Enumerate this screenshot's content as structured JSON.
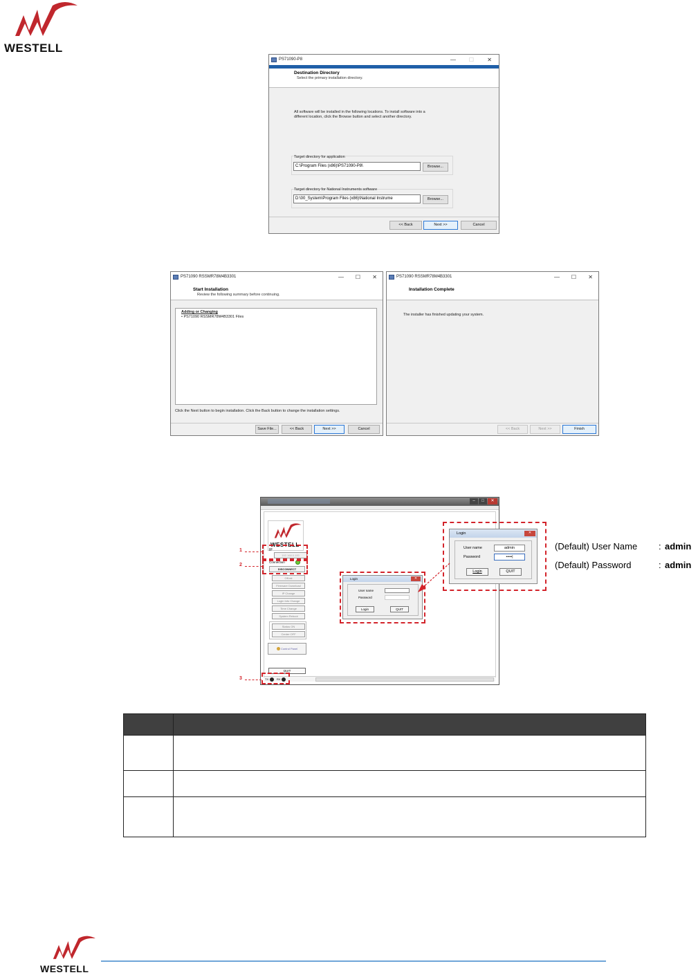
{
  "brand": {
    "logo_text": "WESTELL",
    "footer_logo_text": "WESTELL",
    "logo_color": "#c0272d",
    "footer_line_color": "#6fa5d8"
  },
  "installer_destination": {
    "title": "PS71090-P8",
    "header_title": "Destination Directory",
    "header_subtitle": "Select the primary installation directory.",
    "body_line1": "All software will be installed in the following locations. To install software into a",
    "body_line2": "different location, click the Browse button and select another directory.",
    "app_dir_label": "Target directory for application",
    "app_dir_value": "C:\\Program Files (x86)\\PS71090-P8\\",
    "ni_dir_label": "Target directory for National Instruments software",
    "ni_dir_value": "D:\\00_System\\Program Files (x86)\\National Instrume",
    "browse_label": "Browse...",
    "back_label": "<< Back",
    "next_label": "Next >>",
    "cancel_label": "Cancel"
  },
  "installer_start": {
    "title": "PS71090 RSSMR78M4B3301",
    "header_title": "Start Installation",
    "header_subtitle": "Review the following summary before continuing.",
    "list_heading": "Adding or Changing",
    "list_item": "• PS71090 RSSMR78M4B3301 Files",
    "footer_text": "Click the Next button to begin installation.  Click the Back button to change the installation settings.",
    "save_label": "Save File...",
    "back_label": "<< Back",
    "next_label": "Next >>",
    "cancel_label": "Cancel"
  },
  "installer_complete": {
    "title": "PS71090 RSSMR78M4B3301",
    "header_title": "Installation Complete",
    "body_text": "The installer has finished updating your system.",
    "back_label": "<< Back",
    "next_label": "Next >>",
    "finish_label": "Finish"
  },
  "app_window": {
    "logo_text": "WESTELL",
    "ip_label": "IP",
    "ip_value": "192.168.0.100",
    "connection_label": "Connection",
    "disconnect_label": "DISCONNECT",
    "side_buttons": [
      "Off-rst",
      "Firmware Download",
      "IP Change",
      "Login Info Change",
      "Time Change",
      "System Reboot"
    ],
    "status_on_label": "Status ON",
    "center_off_label": "Center OFF",
    "control_panel_label": "Control Panel",
    "quit_label": "QUIT",
    "tx_label": "TX",
    "rx_label": "RX",
    "callout_1": "1",
    "callout_2": "2",
    "callout_3": "3"
  },
  "login_small": {
    "title": "Login",
    "user_label": "User name",
    "pass_label": "Password",
    "login_label": "Login",
    "quit_label": "QUIT"
  },
  "login_large": {
    "title": "Login",
    "user_label": "User name",
    "user_value": "admin",
    "pass_label": "Password",
    "pass_value": "•••••|",
    "login_label": "Login",
    "quit_label": "QUIT"
  },
  "defaults": {
    "user_prefix": "(Default) User Name",
    "user_sep": ": ",
    "user_value": "admin",
    "pass_prefix": "(Default) Password",
    "pass_sep": ": ",
    "pass_value": "admin"
  },
  "table": {
    "header_col1": "",
    "header_col2": "",
    "rows": [
      [
        "",
        ""
      ],
      [
        "",
        ""
      ],
      [
        "",
        ""
      ]
    ]
  }
}
